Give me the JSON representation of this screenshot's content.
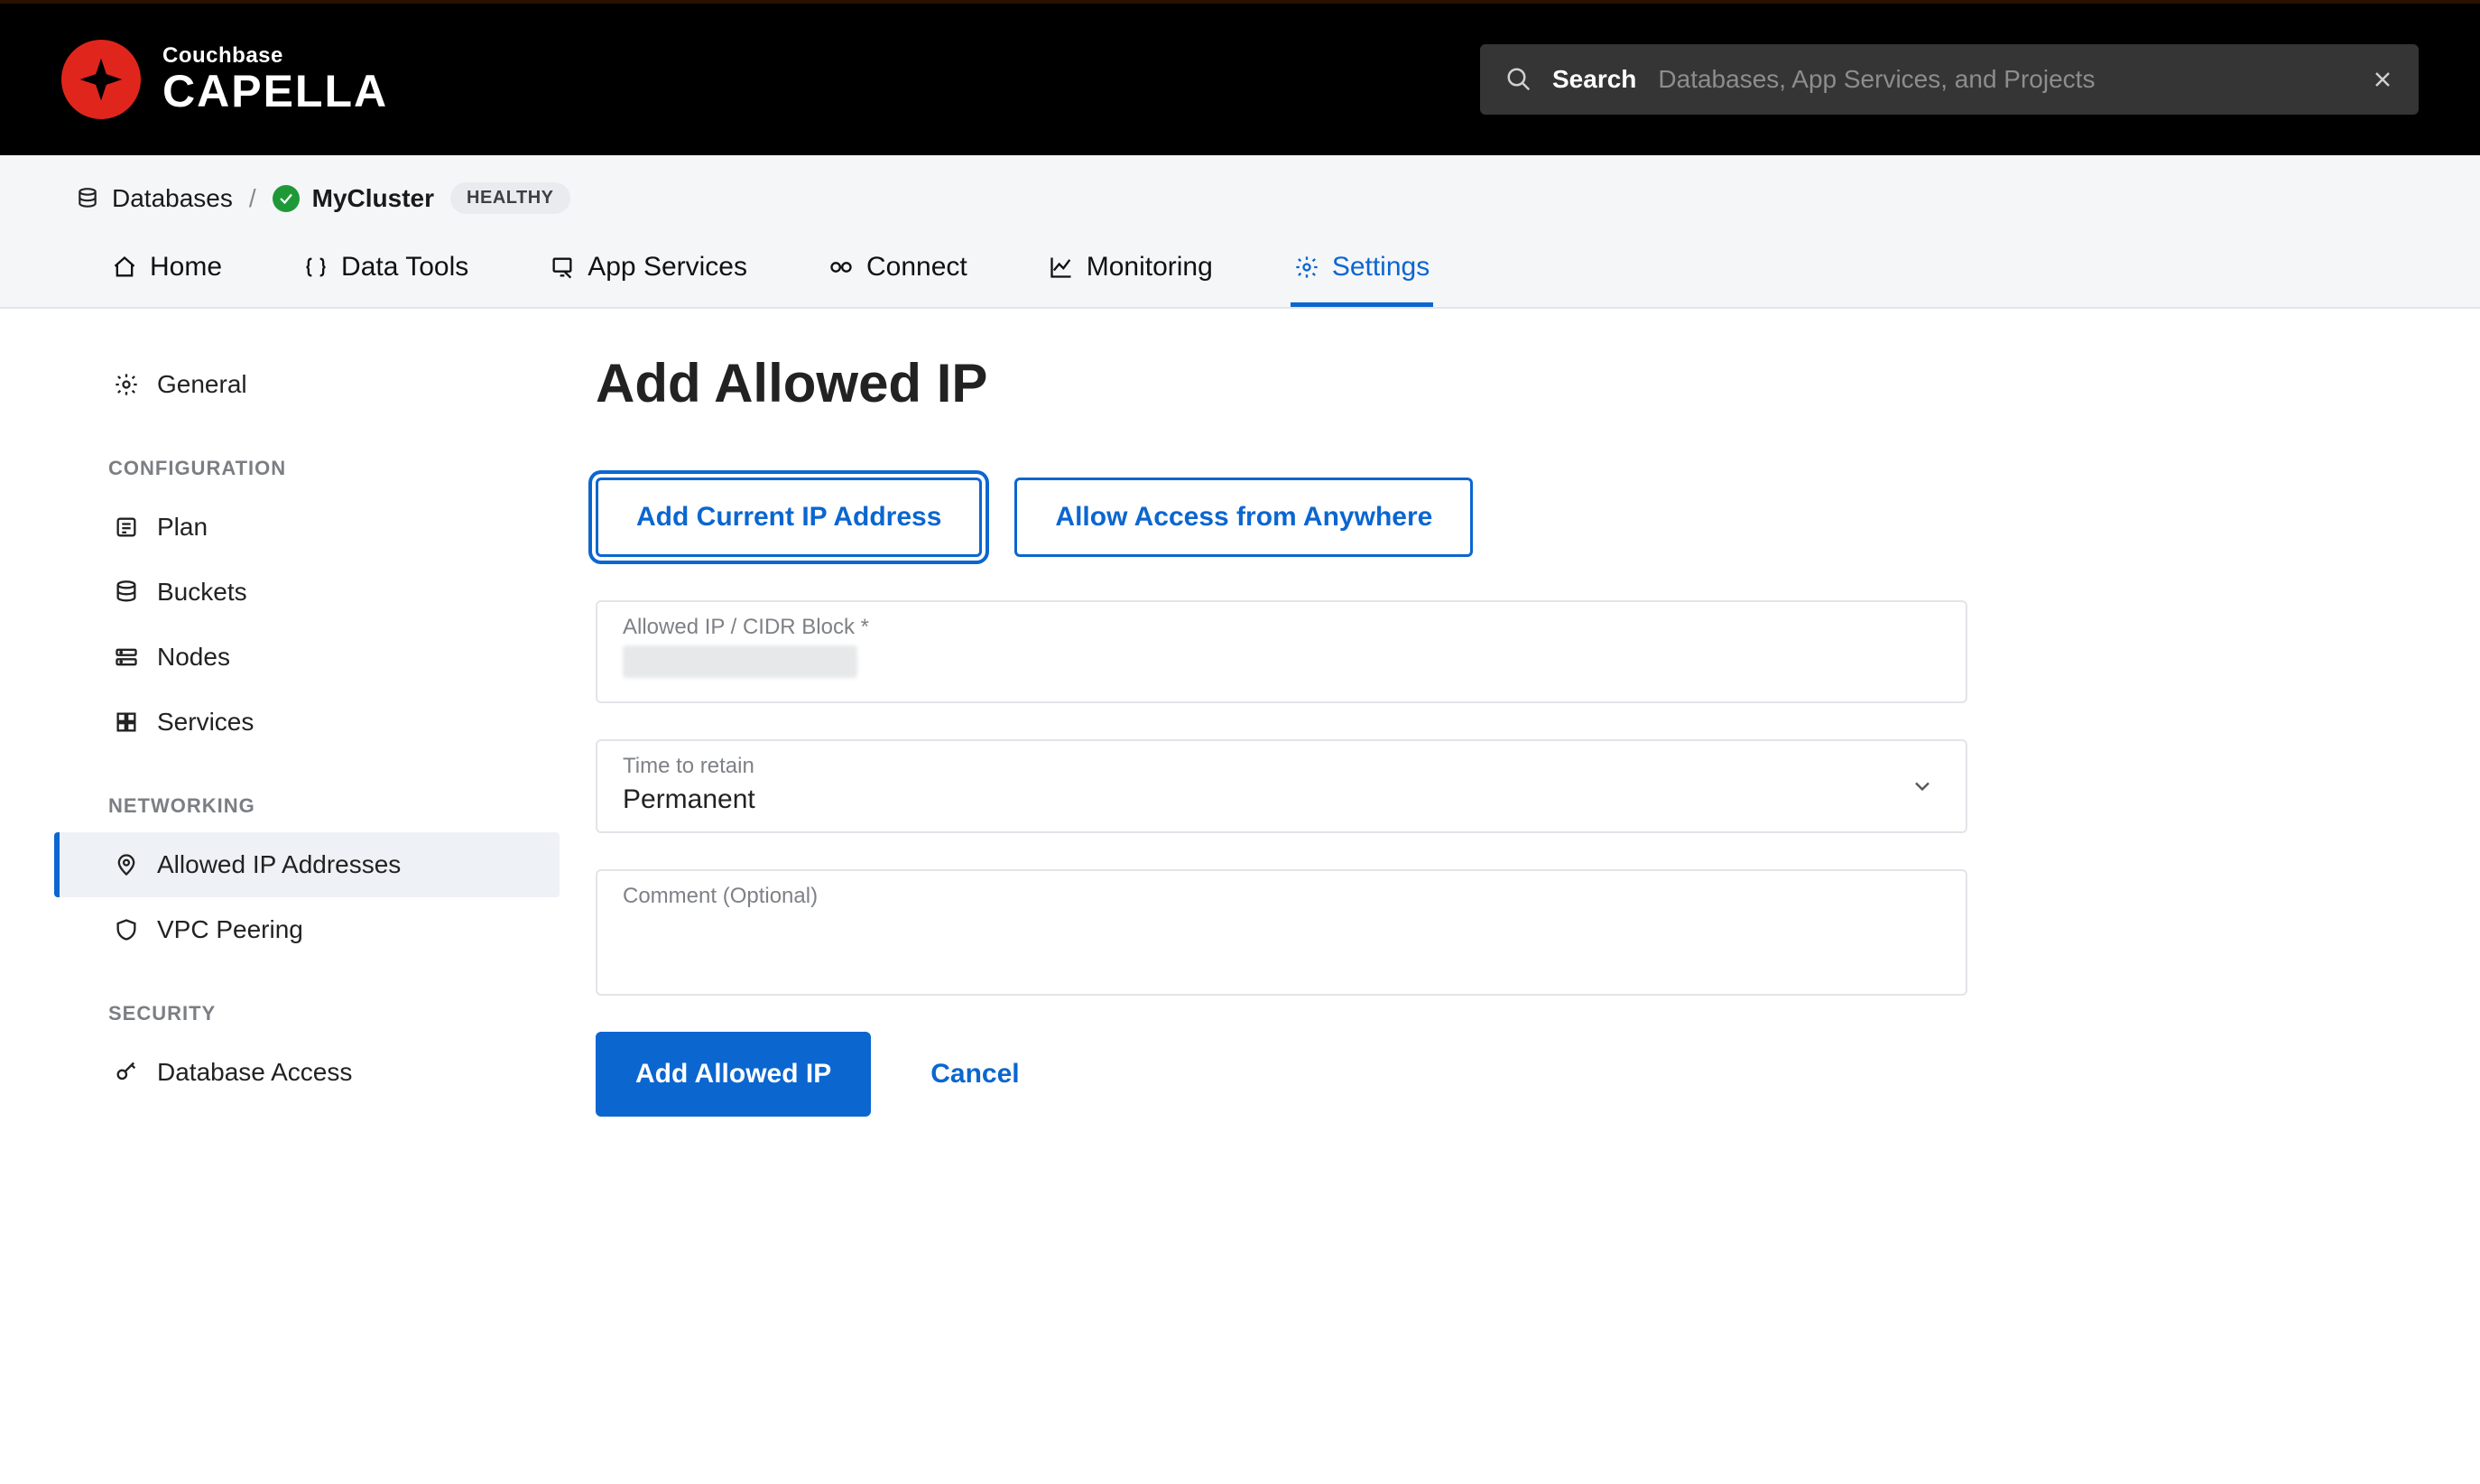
{
  "brand": {
    "small": "Couchbase",
    "large": "CAPELLA"
  },
  "search": {
    "label": "Search",
    "placeholder": "Databases, App Services, and Projects"
  },
  "breadcrumb": {
    "root": "Databases",
    "cluster": "MyCluster",
    "status": "HEALTHY"
  },
  "tabs": [
    {
      "id": "home",
      "label": "Home"
    },
    {
      "id": "data-tools",
      "label": "Data Tools"
    },
    {
      "id": "app-services",
      "label": "App Services"
    },
    {
      "id": "connect",
      "label": "Connect"
    },
    {
      "id": "monitoring",
      "label": "Monitoring"
    },
    {
      "id": "settings",
      "label": "Settings",
      "active": true
    }
  ],
  "sidebar": {
    "top": [
      {
        "id": "general",
        "label": "General",
        "icon": "gear"
      }
    ],
    "groups": [
      {
        "title": "CONFIGURATION",
        "items": [
          {
            "id": "plan",
            "label": "Plan",
            "icon": "list"
          },
          {
            "id": "buckets",
            "label": "Buckets",
            "icon": "db"
          },
          {
            "id": "nodes",
            "label": "Nodes",
            "icon": "nodes"
          },
          {
            "id": "services",
            "label": "Services",
            "icon": "grid"
          }
        ]
      },
      {
        "title": "NETWORKING",
        "items": [
          {
            "id": "allowed-ip",
            "label": "Allowed IP Addresses",
            "icon": "pin",
            "active": true
          },
          {
            "id": "vpc-peering",
            "label": "VPC Peering",
            "icon": "shield"
          }
        ]
      },
      {
        "title": "SECURITY",
        "items": [
          {
            "id": "db-access",
            "label": "Database Access",
            "icon": "key"
          }
        ]
      }
    ]
  },
  "page": {
    "title": "Add Allowed IP",
    "add_current_btn": "Add Current IP Address",
    "allow_anywhere_btn": "Allow Access from Anywhere",
    "ip_label": "Allowed IP / CIDR Block *",
    "retain_label": "Time to retain",
    "retain_value": "Permanent",
    "comment_label": "Comment (Optional)",
    "submit_btn": "Add Allowed IP",
    "cancel_btn": "Cancel"
  }
}
